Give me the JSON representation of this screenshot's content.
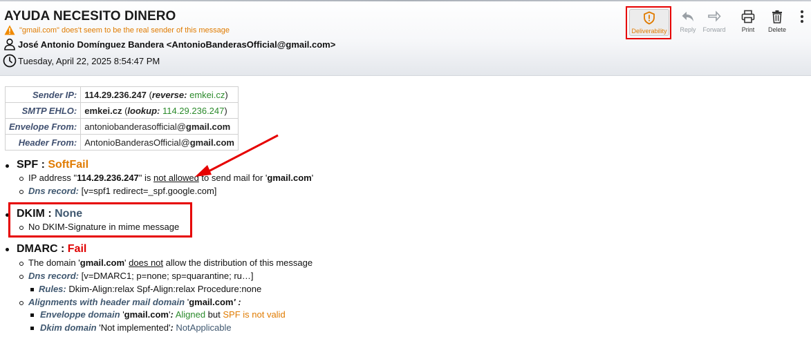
{
  "header": {
    "subject": "AYUDA NECESITO DINERO",
    "warning": "\"gmail.com\" does't seem to be the real sender of this message",
    "from": "José Antonio Domínguez Bandera <AntonioBanderasOfficial@gmail.com>",
    "date": "Tuesday, April 22, 2025 8:54:47 PM"
  },
  "toolbar": {
    "deliverability": "Deliverability",
    "reply": "Reply",
    "forward": "Forward",
    "print": "Print",
    "delete": "Delete"
  },
  "info_table": {
    "sender_ip_label": "Sender IP:",
    "sender_ip": "114.29.236.247",
    "reverse_label": "reverse:",
    "reverse_value": "emkei.cz",
    "smtp_label": "SMTP EHLO:",
    "smtp_value": "emkei.cz",
    "lookup_label": "lookup:",
    "lookup_value": "114.29.236.247",
    "envelope_label": "Envelope From:",
    "envelope_user": "antoniobanderasofficial@",
    "envelope_domain": "gmail.com",
    "headerfrom_label": "Header From:",
    "headerfrom_user": "AntonioBanderasOfficial@",
    "headerfrom_domain": "gmail.com"
  },
  "spf": {
    "label": "SPF :",
    "status": "SoftFail",
    "ip_prefix": "IP address \"",
    "ip": "114.29.236.247",
    "ip_mid": "\" is ",
    "not_allowed": "not allowed",
    "ip_suffix": " to send mail for '",
    "domain": "gmail.com",
    "quote_end": "'",
    "dns_label": "Dns record:",
    "dns_value": " [v=spf1 redirect=_spf.google.com]"
  },
  "dkim": {
    "label": "DKIM :",
    "status": "None",
    "detail": "No DKIM-Signature in mime message"
  },
  "dmarc": {
    "label": "DMARC :",
    "status": "Fail",
    "domain_prefix": "The domain '",
    "domain": "gmail.com",
    "domain_mid": "' ",
    "does_not": "does not",
    "domain_suffix": " allow the distribution of this message",
    "dns_label": "Dns record:",
    "dns_value": " [v=DMARC1; p=none; sp=quarantine; ru…]",
    "rules_label": "Rules:",
    "rules_value": " Dkim-Align:relax Spf-Align:relax Procedure:none",
    "align_label": "Alignments with header mail domain",
    "align_q1": " '",
    "align_domain": "gmail.com",
    "align_q2": "' :",
    "env_label": "Enveloppe domain",
    "env_q1": " '",
    "env_domain": "gmail.com",
    "env_q2": "'",
    "env_colon": ":",
    "aligned": " Aligned",
    "but": " but ",
    "spf_invalid": "SPF is not valid",
    "dkim_label": "Dkim domain",
    "dkim_q": " 'Not implemented'",
    "dkim_colon": ":",
    "not_applicable": " NotApplicable"
  }
}
